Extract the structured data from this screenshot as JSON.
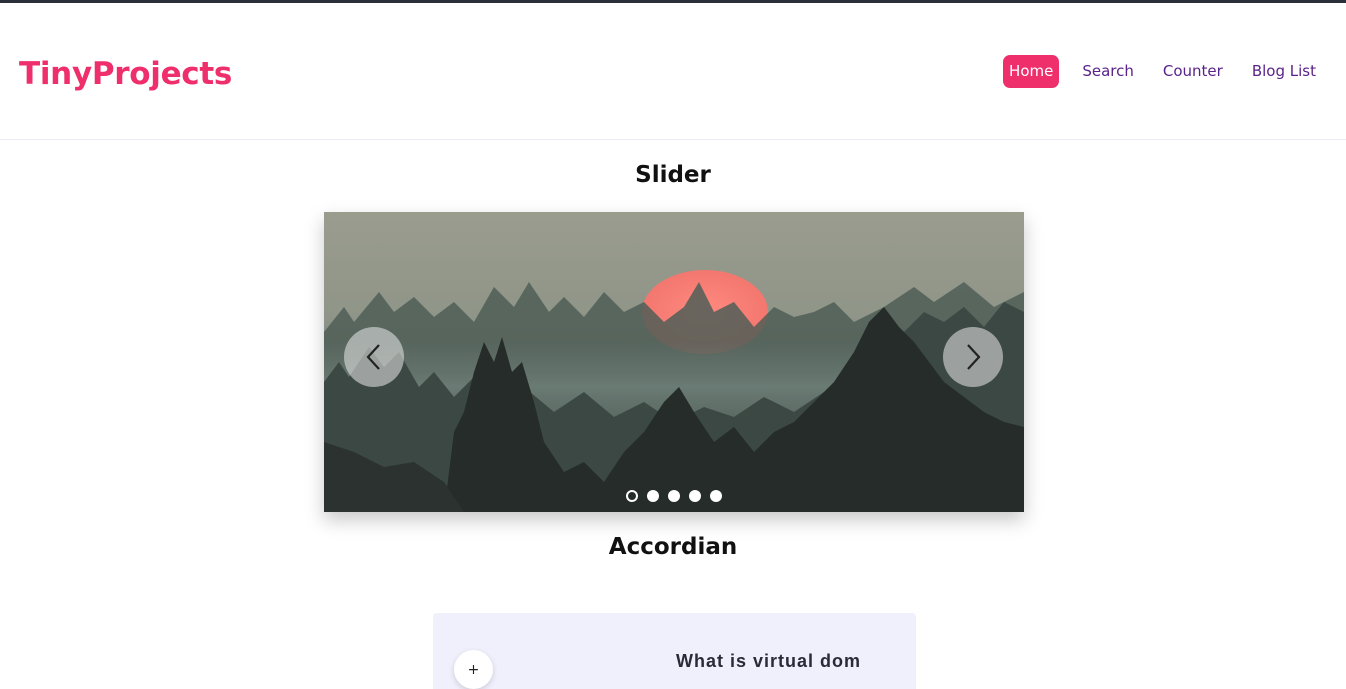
{
  "header": {
    "brand": "TinyProjects",
    "nav": [
      {
        "label": "Home",
        "active": true
      },
      {
        "label": "Search",
        "active": false
      },
      {
        "label": "Counter",
        "active": false
      },
      {
        "label": "Blog List",
        "active": false
      }
    ]
  },
  "slider": {
    "title": "Slider",
    "prev_icon": "chevron-left-icon",
    "next_icon": "chevron-right-icon",
    "dot_count": 5,
    "active_dot": 1
  },
  "accordion": {
    "title": "Accordian",
    "toggle_symbol": "+",
    "items": [
      {
        "question": "What is virtual dom"
      }
    ]
  },
  "colors": {
    "brand": "#ee2f6c",
    "nav_text": "#5a2389",
    "accordion_bg": "#eff0fc"
  }
}
